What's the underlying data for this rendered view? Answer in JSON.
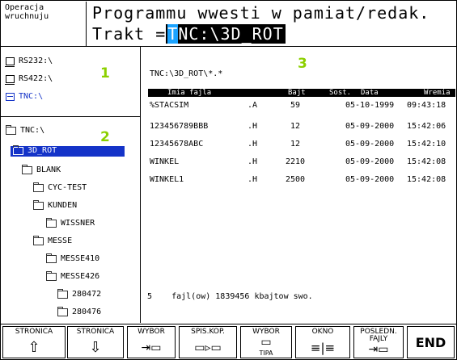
{
  "header": {
    "mode_label": "Operacja\nwruchnuju",
    "title": "Programmu wwesti w pamiat/redak.",
    "path_prefix": "Trakt =",
    "path_cursor": "T",
    "path_rest": "NC:\\3D_ROT"
  },
  "tree": {
    "drives": [
      {
        "label": "RS232:\\",
        "icon": "drive-icon"
      },
      {
        "label": "RS422:\\",
        "icon": "drive-icon"
      },
      {
        "label": "TNC:\\",
        "icon": "tnc-drive-icon"
      }
    ],
    "dirs": [
      {
        "label": "TNC:\\"
      },
      {
        "label": "3D_ROT"
      },
      {
        "label": "BLANK"
      },
      {
        "label": "CYC-TEST"
      },
      {
        "label": "KUNDEN"
      },
      {
        "label": "WISSNER"
      },
      {
        "label": "MESSE"
      },
      {
        "label": "MESSE410"
      },
      {
        "label": "MESSE426"
      },
      {
        "label": "280472"
      },
      {
        "label": "280476"
      }
    ]
  },
  "markers": {
    "m1": "1",
    "m2": "2",
    "m3": "3"
  },
  "files": {
    "mask": "TNC:\\3D_ROT\\*.*",
    "columns": {
      "name": "Imia fajla",
      "size": "Bajt",
      "status": "Sost.",
      "date": "Data",
      "time": "Wremia"
    },
    "rows": [
      {
        "name": "%STACSIM",
        "ext": ".A",
        "size": "59",
        "date": "05-10-1999",
        "time": "09:43:18"
      },
      {
        "name": "123456789BBB",
        "ext": ".H",
        "size": "12",
        "date": "05-09-2000",
        "time": "15:42:06"
      },
      {
        "name": "12345678ABC",
        "ext": ".H",
        "size": "12",
        "date": "05-09-2000",
        "time": "15:42:10"
      },
      {
        "name": "WINKEL",
        "ext": ".H",
        "size": "2210",
        "date": "05-09-2000",
        "time": "15:42:08"
      },
      {
        "name": "WINKEL1",
        "ext": ".H",
        "size": "2500",
        "date": "05-09-2000",
        "time": "15:42:08"
      }
    ],
    "status": "5    fajl(ow) 1839456 kbajtow swo."
  },
  "softkeys": [
    {
      "label": "STRONICA",
      "glyph": "⇧"
    },
    {
      "label": "STRONICA",
      "glyph": "⇩"
    },
    {
      "label": "WYBOR",
      "glyph": "⇥▭"
    },
    {
      "label": "SPIS.KOP.",
      "glyph": "▭▹▭"
    },
    {
      "label": "WYBOR",
      "glyph": "▭",
      "sub": "TIPA"
    },
    {
      "label": "OKNO",
      "glyph": "≡|≡"
    },
    {
      "label": "POSLEDN.\nFAJLY",
      "glyph": "⇥▭"
    },
    {
      "label": "END",
      "glyph": ""
    }
  ],
  "colors": {
    "accent": "#1433c8",
    "cursor": "#1ba3ff",
    "marker": "#8cd000"
  }
}
